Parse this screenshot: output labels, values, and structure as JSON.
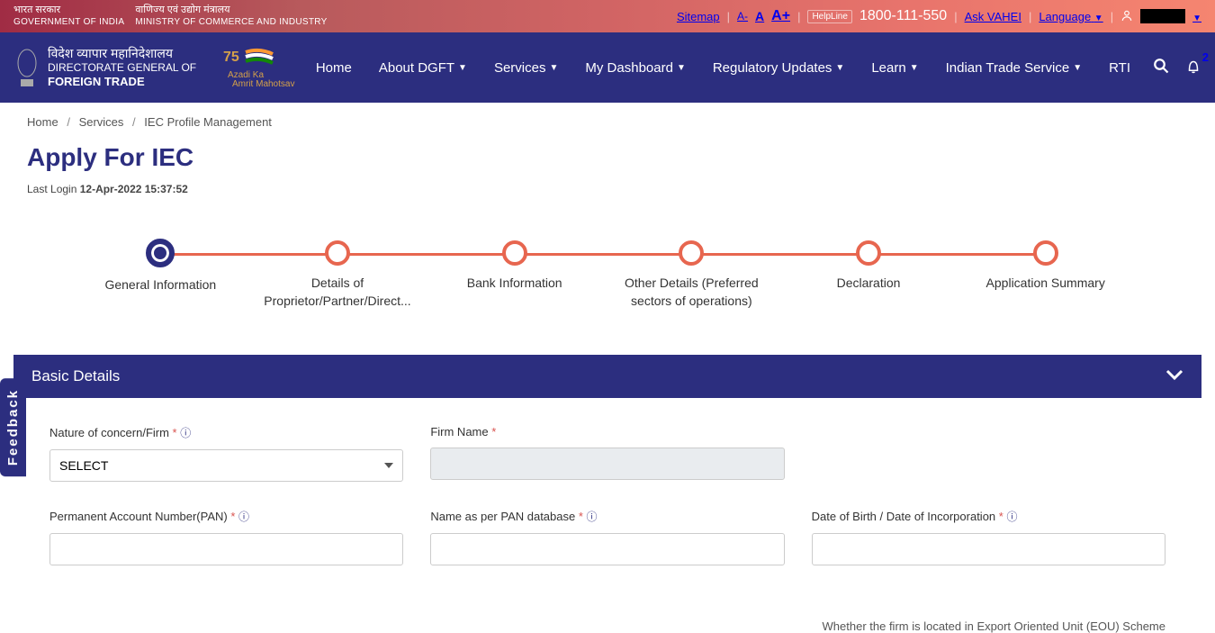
{
  "topbar": {
    "left": {
      "col1_hindi": "भारत सरकार",
      "col1_eng": "GOVERNMENT OF INDIA",
      "col2_hindi": "वाणिज्य एवं उद्योग मंत्रालय",
      "col2_eng": "MINISTRY OF COMMERCE AND INDUSTRY"
    },
    "sitemap": "Sitemap",
    "font_small": "A-",
    "font_med": "A",
    "font_large": "A+",
    "helpline_label": "HelpLine",
    "phone": "1800-111-550",
    "ask": "Ask VAHEI",
    "language": "Language"
  },
  "nav": {
    "logo_hindi": "विदेश व्यापार महानिदेशालय",
    "logo_eng1": "DIRECTORATE GENERAL OF",
    "logo_eng2": "FOREIGN TRADE",
    "mahotsav_l1": "Azadi Ka",
    "mahotsav_l2": "Amrit Mahotsav",
    "links": {
      "home": "Home",
      "about": "About DGFT",
      "services": "Services",
      "dashboard": "My Dashboard",
      "regulatory": "Regulatory Updates",
      "learn": "Learn",
      "its": "Indian Trade Service",
      "rti": "RTI"
    },
    "notif_count": "2"
  },
  "breadcrumb": {
    "home": "Home",
    "services": "Services",
    "current": "IEC Profile Management"
  },
  "page": {
    "title": "Apply For IEC",
    "last_login_label": "Last Login ",
    "last_login_ts": "12-Apr-2022 15:37:52"
  },
  "steps": {
    "s1": "General Information",
    "s2": "Details of Proprietor/Partner/Direct...",
    "s3": "Bank Information",
    "s4": "Other Details (Preferred sectors of operations)",
    "s5": "Declaration",
    "s6": "Application Summary"
  },
  "panel": {
    "title": "Basic Details",
    "nature_label": "Nature of concern/Firm ",
    "nature_select": "SELECT",
    "firm_label": "Firm Name ",
    "pan_label": "Permanent Account Number(PAN) ",
    "panname_label": "Name as per PAN database ",
    "dob_label": "Date of Birth / Date of Incorporation ",
    "hint": "Whether the firm is located in Export Oriented Unit (EOU) Scheme"
  },
  "feedback": "Feedback"
}
